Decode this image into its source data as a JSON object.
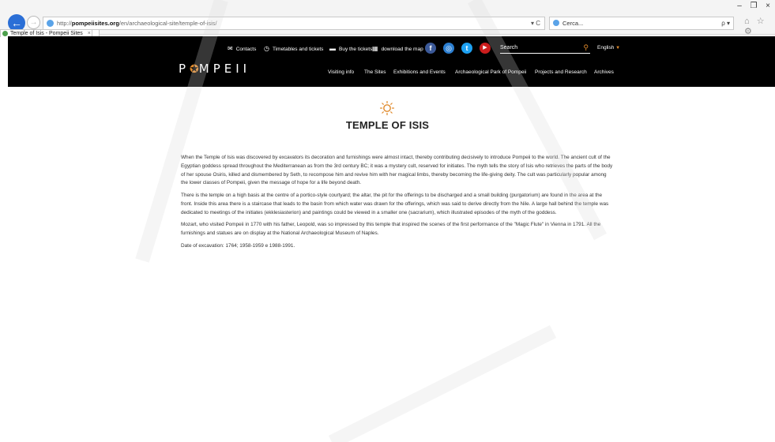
{
  "browser": {
    "url_protocol": "http://",
    "url_host": "pompeiisites.org",
    "url_path": "/en/archaeological-site/temple-of-isis/",
    "url_tools": "▾ C",
    "search_placeholder": "Cerca...",
    "search_tools": "ρ ▾",
    "tab_title": "Temple of Isis - Pompeii Sites",
    "tab_close": "×",
    "back_icon": "arrow-left-icon",
    "forward_icon": "arrow-right-icon",
    "right_icons": "⌂ ☆ ⚙",
    "window_controls": [
      "–",
      "❐",
      "×"
    ]
  },
  "site": {
    "topbar": {
      "contacts": "Contacts",
      "timetables": "Timetables and tickets",
      "buy_tickets": "Buy the tickets",
      "download_map": "download the map",
      "search_label": "Search",
      "language": "English",
      "social": [
        {
          "name": "facebook-icon",
          "glyph": "f",
          "color": "#3b5998"
        },
        {
          "name": "instagram-icon",
          "glyph": "◎",
          "color": "#2c7fd1"
        },
        {
          "name": "twitter-icon",
          "glyph": "t",
          "color": "#1da1f2"
        },
        {
          "name": "youtube-icon",
          "glyph": "▶",
          "color": "#cc1d1d"
        }
      ]
    },
    "logo_text_left": "P",
    "logo_text_right": "MPEII",
    "nav": [
      "Visiting info",
      "The Sites",
      "Exhibitions and Events",
      "Archaeological Park of Pompeii",
      "Projects and Research",
      "Archives"
    ],
    "accent_color": "#e08a2c"
  },
  "page": {
    "title": "TEMPLE OF ISIS",
    "paragraphs": [
      "When the Temple of Isis was discovered by excavators its decoration and furnishings were almost intact, thereby contributing decisively to introduce Pompeii to the world. The ancient cult of the Egyptian goddess spread throughout the Mediterranean as from the 3rd century BC; it was a mystery cult, reserved for initiates. The myth tells the story of Isis who retrieves the parts of the body of her spouse Osiris, killed and dismembered by Seth, to recompose him and revive him with her magical limbs, thereby becoming the life-giving deity. The cult was particularly popular among the lower classes of Pompeii, given the message of hope for a life beyond death.",
      "There is the temple on a high basis at the centre of a portico-style courtyard; the altar, the pit for the offerings to be discharged and a small building (purgatorium) are found in the area at the front. Inside this area there is a staircase that leads to the basin from which water was drawn for the offerings, which was said to derive directly from the Nile. A large hall behind the temple was dedicated to meetings of the initiates (ekklesiasterion) and paintings could be viewed in a smaller one (sacrarium), which illustrated episodes of the myth of the goddess.",
      "Mozart, who visited Pompeii in 1770 with his father, Leopold, was so impressed by this temple that inspired the scenes of the first performance of the \"Magic Flute\" in Vienna in 1791. All the furnishings and statues are on display at the National Archaeological Museum of Naples.",
      "Date of excavation: 1764; 1958-1959 e 1988-1991."
    ]
  }
}
